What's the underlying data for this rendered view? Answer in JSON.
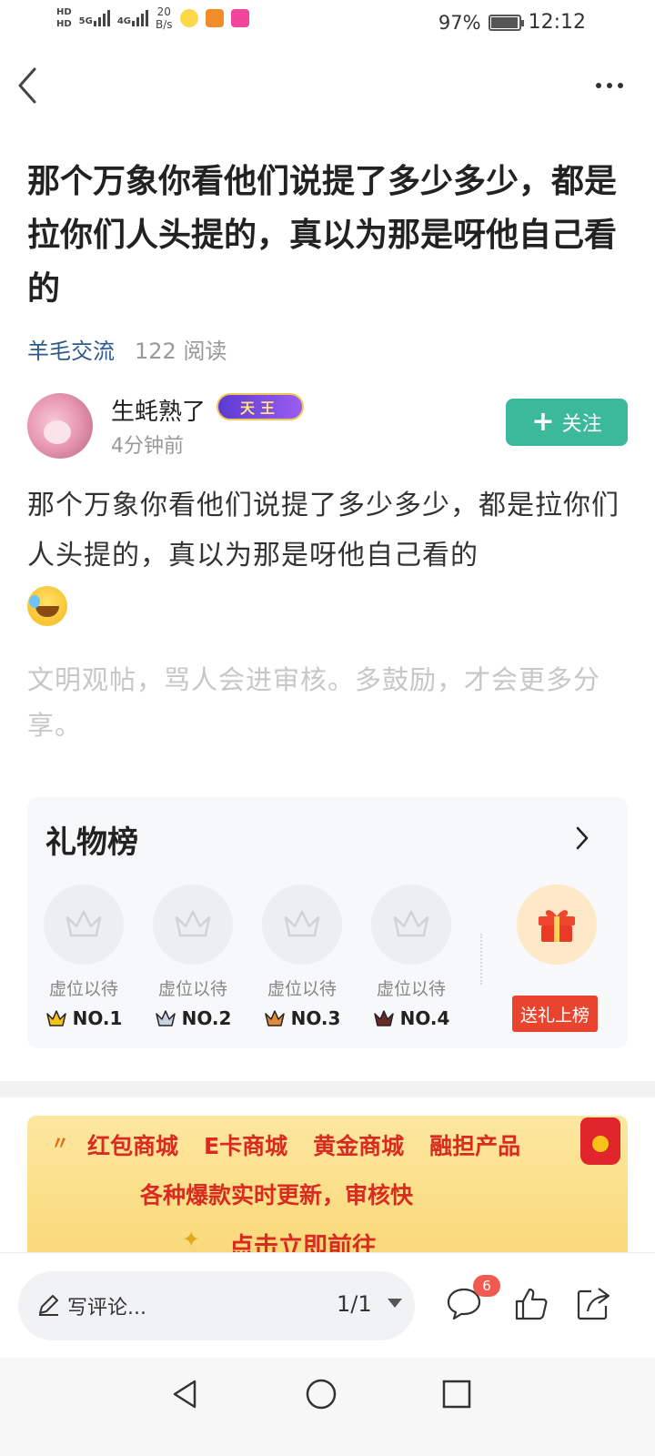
{
  "status_bar": {
    "hd1": "HD",
    "hd2": "HD",
    "net1": "5G",
    "net2": "4G",
    "speed_value": "20",
    "speed_unit": "B/s",
    "battery": "97%",
    "battery_level": 0.97,
    "time": "12:12"
  },
  "post": {
    "title": "那个万象你看他们说提了多少多少，都是拉你们人头提的，真以为那是呀他自己看的",
    "board": "羊毛交流",
    "reads": "122 阅读",
    "body": "那个万象你看他们说提了多少多少，都是拉你们人头提的，真以为那是呀他自己看的",
    "notice": "文明观帖，骂人会进审核。多鼓励，才会更多分享。"
  },
  "author": {
    "name": "生蚝熟了",
    "badge": "天王",
    "time": "4分钟前",
    "follow_label": "关注"
  },
  "gift_rank": {
    "title": "礼物榜",
    "slots": [
      {
        "label": "虚位以待",
        "rank": "NO.1"
      },
      {
        "label": "虚位以待",
        "rank": "NO.2"
      },
      {
        "label": "虚位以待",
        "rank": "NO.3"
      },
      {
        "label": "虚位以待",
        "rank": "NO.4"
      }
    ],
    "send_label": "送礼上榜"
  },
  "banner": {
    "items": [
      "红包商城",
      "E卡商城",
      "黄金商城",
      "融担产品"
    ],
    "line2": "各种爆款实时更新，审核快",
    "line3": "点击立即前往"
  },
  "bottom_bar": {
    "comment_placeholder": "写评论...",
    "page_indicator": "1/1",
    "comment_count": "6"
  },
  "colors": {
    "accent_green": "#3cb89a",
    "link_blue": "#2f5a8a",
    "gift_red": "#e8442e",
    "badge_red": "#f15b4f"
  }
}
